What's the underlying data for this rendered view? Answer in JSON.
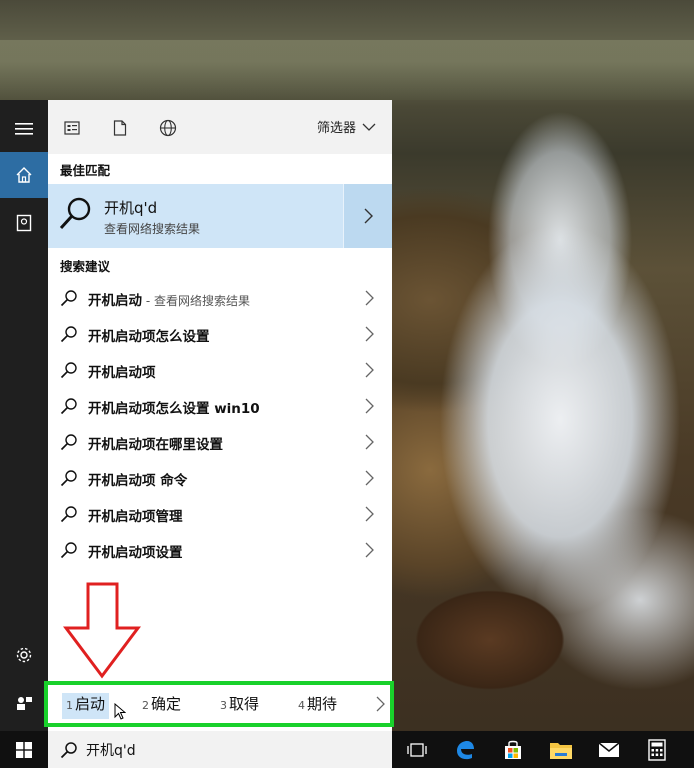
{
  "toolbar": {
    "filter_label": "筛选器"
  },
  "best_match": {
    "header": "最佳匹配",
    "title": "开机q'd",
    "subtitle": "查看网络搜索结果"
  },
  "suggestions": {
    "header": "搜索建议",
    "items": [
      {
        "bold": "开机启动",
        "rest": "",
        "hint": " - 查看网络搜索结果"
      },
      {
        "bold": "开机启动",
        "rest": "项怎么设置",
        "hint": ""
      },
      {
        "bold": "开机启动",
        "rest": "项",
        "hint": ""
      },
      {
        "bold": "开机启动",
        "rest": "项怎么设置 win10",
        "hint": ""
      },
      {
        "bold": "开机启动",
        "rest": "项在哪里设置",
        "hint": ""
      },
      {
        "bold": "开机启动",
        "rest": "项 命令",
        "hint": ""
      },
      {
        "bold": "开机启动",
        "rest": "项管理",
        "hint": ""
      },
      {
        "bold": "开机启动",
        "rest": "项设置",
        "hint": ""
      }
    ]
  },
  "ime": {
    "candidates": [
      {
        "num": "1",
        "text": "启动"
      },
      {
        "num": "2",
        "text": "确定"
      },
      {
        "num": "3",
        "text": "取得"
      },
      {
        "num": "4",
        "text": "期待"
      }
    ]
  },
  "search": {
    "value": "开机q'd"
  },
  "colors": {
    "accent": "#2d6da3",
    "highlight": "#cfe5f7",
    "ime_border": "#19d12b",
    "annotation": "#e02020"
  },
  "taskbar": {
    "apps": [
      "task-view-icon",
      "edge-icon",
      "store-icon",
      "file-explorer-icon",
      "mail-icon",
      "calculator-icon"
    ]
  }
}
